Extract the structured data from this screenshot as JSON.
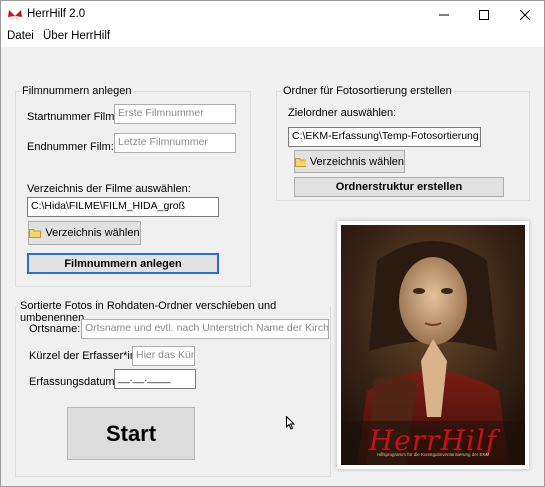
{
  "window": {
    "title": "HerrHilf 2.0"
  },
  "menubar": {
    "items": [
      "Datei",
      "Über HerrHilf"
    ]
  },
  "film_group": {
    "title": "Filmnummern anlegen",
    "start_label": "Startnummer Film:",
    "start_placeholder": "Erste Filmnummer",
    "end_label": "Endnummer Film:",
    "end_placeholder": "Letzte Filmnummer",
    "dir_label": "Verzeichnis der Filme auswählen:",
    "dir_value": "C:\\Hida\\FILME\\FILM_HIDA_groß",
    "choose_button": "Verzeichnis wählen",
    "create_button": "Filmnummern anlegen"
  },
  "ordner_group": {
    "title": "Ordner für Fotosortierung erstellen",
    "target_label": "Zielordner auswählen:",
    "target_value": "C:\\EKM-Erfassung\\Temp-Fotosortierung",
    "choose_button": "Verzeichnis wählen",
    "create_button": "Ordnerstruktur erstellen"
  },
  "sort_group": {
    "title": "Sortierte Fotos in Rohdaten-Ordner verschieben und umbenennen",
    "ort_label": "Ortsname:",
    "ort_placeholder": "Ortsname und evtl. nach Unterstrich Name der Kirche",
    "kuerzel_label": "Kürzel der Erfasser*in:",
    "kuerzel_placeholder": "Hier das Kürzel",
    "datum_label": "Erfassungsdatum:",
    "datum_value": "__.__.____",
    "start_button": "Start"
  },
  "logo": {
    "text": "HerrHilf",
    "tagline": "Hilfsprogramm für die Kunstgutinventarisierung der EKM"
  },
  "colors": {
    "logo_red": "#c0141c",
    "default_button_border": "#2b6fce",
    "painting_dark": "#2a1a12"
  }
}
